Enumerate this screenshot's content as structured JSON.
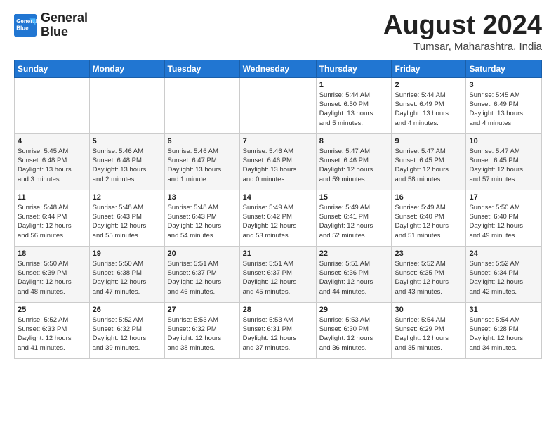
{
  "header": {
    "logo_line1": "General",
    "logo_line2": "Blue",
    "month_year": "August 2024",
    "location": "Tumsar, Maharashtra, India"
  },
  "days_of_week": [
    "Sunday",
    "Monday",
    "Tuesday",
    "Wednesday",
    "Thursday",
    "Friday",
    "Saturday"
  ],
  "weeks": [
    [
      {
        "day": "",
        "info": ""
      },
      {
        "day": "",
        "info": ""
      },
      {
        "day": "",
        "info": ""
      },
      {
        "day": "",
        "info": ""
      },
      {
        "day": "1",
        "info": "Sunrise: 5:44 AM\nSunset: 6:50 PM\nDaylight: 13 hours\nand 5 minutes."
      },
      {
        "day": "2",
        "info": "Sunrise: 5:44 AM\nSunset: 6:49 PM\nDaylight: 13 hours\nand 4 minutes."
      },
      {
        "day": "3",
        "info": "Sunrise: 5:45 AM\nSunset: 6:49 PM\nDaylight: 13 hours\nand 4 minutes."
      }
    ],
    [
      {
        "day": "4",
        "info": "Sunrise: 5:45 AM\nSunset: 6:48 PM\nDaylight: 13 hours\nand 3 minutes."
      },
      {
        "day": "5",
        "info": "Sunrise: 5:46 AM\nSunset: 6:48 PM\nDaylight: 13 hours\nand 2 minutes."
      },
      {
        "day": "6",
        "info": "Sunrise: 5:46 AM\nSunset: 6:47 PM\nDaylight: 13 hours\nand 1 minute."
      },
      {
        "day": "7",
        "info": "Sunrise: 5:46 AM\nSunset: 6:46 PM\nDaylight: 13 hours\nand 0 minutes."
      },
      {
        "day": "8",
        "info": "Sunrise: 5:47 AM\nSunset: 6:46 PM\nDaylight: 12 hours\nand 59 minutes."
      },
      {
        "day": "9",
        "info": "Sunrise: 5:47 AM\nSunset: 6:45 PM\nDaylight: 12 hours\nand 58 minutes."
      },
      {
        "day": "10",
        "info": "Sunrise: 5:47 AM\nSunset: 6:45 PM\nDaylight: 12 hours\nand 57 minutes."
      }
    ],
    [
      {
        "day": "11",
        "info": "Sunrise: 5:48 AM\nSunset: 6:44 PM\nDaylight: 12 hours\nand 56 minutes."
      },
      {
        "day": "12",
        "info": "Sunrise: 5:48 AM\nSunset: 6:43 PM\nDaylight: 12 hours\nand 55 minutes."
      },
      {
        "day": "13",
        "info": "Sunrise: 5:48 AM\nSunset: 6:43 PM\nDaylight: 12 hours\nand 54 minutes."
      },
      {
        "day": "14",
        "info": "Sunrise: 5:49 AM\nSunset: 6:42 PM\nDaylight: 12 hours\nand 53 minutes."
      },
      {
        "day": "15",
        "info": "Sunrise: 5:49 AM\nSunset: 6:41 PM\nDaylight: 12 hours\nand 52 minutes."
      },
      {
        "day": "16",
        "info": "Sunrise: 5:49 AM\nSunset: 6:40 PM\nDaylight: 12 hours\nand 51 minutes."
      },
      {
        "day": "17",
        "info": "Sunrise: 5:50 AM\nSunset: 6:40 PM\nDaylight: 12 hours\nand 49 minutes."
      }
    ],
    [
      {
        "day": "18",
        "info": "Sunrise: 5:50 AM\nSunset: 6:39 PM\nDaylight: 12 hours\nand 48 minutes."
      },
      {
        "day": "19",
        "info": "Sunrise: 5:50 AM\nSunset: 6:38 PM\nDaylight: 12 hours\nand 47 minutes."
      },
      {
        "day": "20",
        "info": "Sunrise: 5:51 AM\nSunset: 6:37 PM\nDaylight: 12 hours\nand 46 minutes."
      },
      {
        "day": "21",
        "info": "Sunrise: 5:51 AM\nSunset: 6:37 PM\nDaylight: 12 hours\nand 45 minutes."
      },
      {
        "day": "22",
        "info": "Sunrise: 5:51 AM\nSunset: 6:36 PM\nDaylight: 12 hours\nand 44 minutes."
      },
      {
        "day": "23",
        "info": "Sunrise: 5:52 AM\nSunset: 6:35 PM\nDaylight: 12 hours\nand 43 minutes."
      },
      {
        "day": "24",
        "info": "Sunrise: 5:52 AM\nSunset: 6:34 PM\nDaylight: 12 hours\nand 42 minutes."
      }
    ],
    [
      {
        "day": "25",
        "info": "Sunrise: 5:52 AM\nSunset: 6:33 PM\nDaylight: 12 hours\nand 41 minutes."
      },
      {
        "day": "26",
        "info": "Sunrise: 5:52 AM\nSunset: 6:32 PM\nDaylight: 12 hours\nand 39 minutes."
      },
      {
        "day": "27",
        "info": "Sunrise: 5:53 AM\nSunset: 6:32 PM\nDaylight: 12 hours\nand 38 minutes."
      },
      {
        "day": "28",
        "info": "Sunrise: 5:53 AM\nSunset: 6:31 PM\nDaylight: 12 hours\nand 37 minutes."
      },
      {
        "day": "29",
        "info": "Sunrise: 5:53 AM\nSunset: 6:30 PM\nDaylight: 12 hours\nand 36 minutes."
      },
      {
        "day": "30",
        "info": "Sunrise: 5:54 AM\nSunset: 6:29 PM\nDaylight: 12 hours\nand 35 minutes."
      },
      {
        "day": "31",
        "info": "Sunrise: 5:54 AM\nSunset: 6:28 PM\nDaylight: 12 hours\nand 34 minutes."
      }
    ]
  ]
}
